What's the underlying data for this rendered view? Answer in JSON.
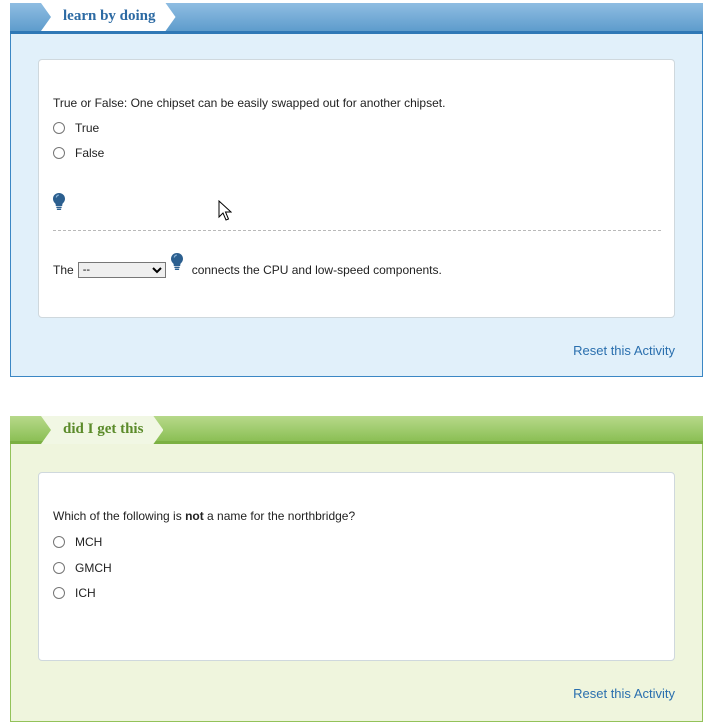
{
  "learn_by_doing": {
    "title": "learn by doing",
    "question1": "True or False: One chipset can be easily swapped out for another chipset.",
    "options1": [
      "True",
      "False"
    ],
    "sentence_prefix": "The",
    "select_value": "--",
    "sentence_suffix": "connects the CPU and low-speed components.",
    "reset_label": "Reset this Activity",
    "hint_icon": "lightbulb-icon"
  },
  "did_i_get_this": {
    "title": "did I get this",
    "question_prefix": "Which of the following is ",
    "question_bold": "not",
    "question_suffix": " a name for the northbridge?",
    "options": [
      "MCH",
      "GMCH",
      "ICH"
    ],
    "reset_label": "Reset this Activity"
  },
  "colors": {
    "blue_accent": "#2f78b6",
    "blue_panel": "#e1f0fa",
    "green_accent": "#7bb042",
    "green_panel": "#eff5dd",
    "link": "#2a6fae"
  }
}
